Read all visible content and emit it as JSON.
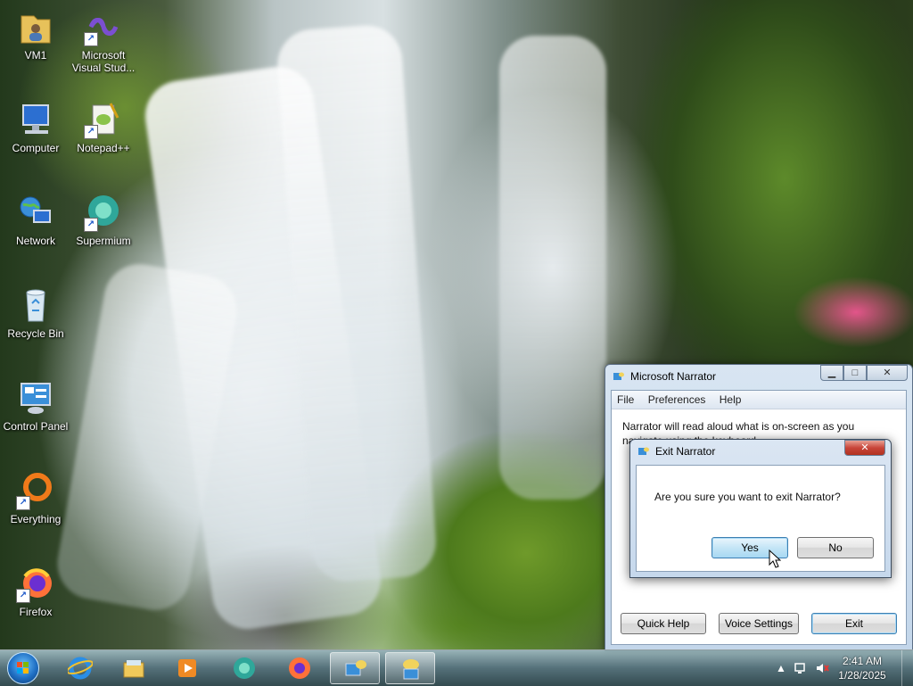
{
  "desktop_icons": [
    {
      "label": "VM1",
      "icon": "folder-user-icon"
    },
    {
      "label": "Microsoft Visual Stud...",
      "icon": "visual-studio-icon"
    },
    {
      "label": "Computer",
      "icon": "computer-icon"
    },
    {
      "label": "Notepad++",
      "icon": "notepad-plus-plus-icon"
    },
    {
      "label": "Network",
      "icon": "network-icon"
    },
    {
      "label": "Supermium",
      "icon": "supermium-icon"
    },
    {
      "label": "Recycle Bin",
      "icon": "recycle-bin-icon"
    },
    {
      "label": "Control Panel",
      "icon": "control-panel-icon"
    },
    {
      "label": "Everything",
      "icon": "everything-icon"
    },
    {
      "label": "Firefox",
      "icon": "firefox-icon"
    }
  ],
  "narrator": {
    "title": "Microsoft Narrator",
    "menu": [
      "File",
      "Preferences",
      "Help"
    ],
    "text": "Narrator will read aloud what is on-screen as you navigate using the keyboard.",
    "buttons": {
      "quick_help": "Quick Help",
      "voice_settings": "Voice Settings",
      "exit": "Exit"
    }
  },
  "exit_dialog": {
    "title": "Exit Narrator",
    "message": "Are you sure you want to exit Narrator?",
    "yes": "Yes",
    "no": "No"
  },
  "taskbar": {
    "pinned": [
      "internet-explorer-icon",
      "file-explorer-icon",
      "media-player-icon",
      "supermium-icon",
      "firefox-icon",
      "narrator-icon",
      "narrator-dialog-icon"
    ],
    "time": "2:41 AM",
    "date": "1/28/2025"
  },
  "colors": {
    "accent": "#3c7fb1",
    "close_red": "#c8453a"
  }
}
